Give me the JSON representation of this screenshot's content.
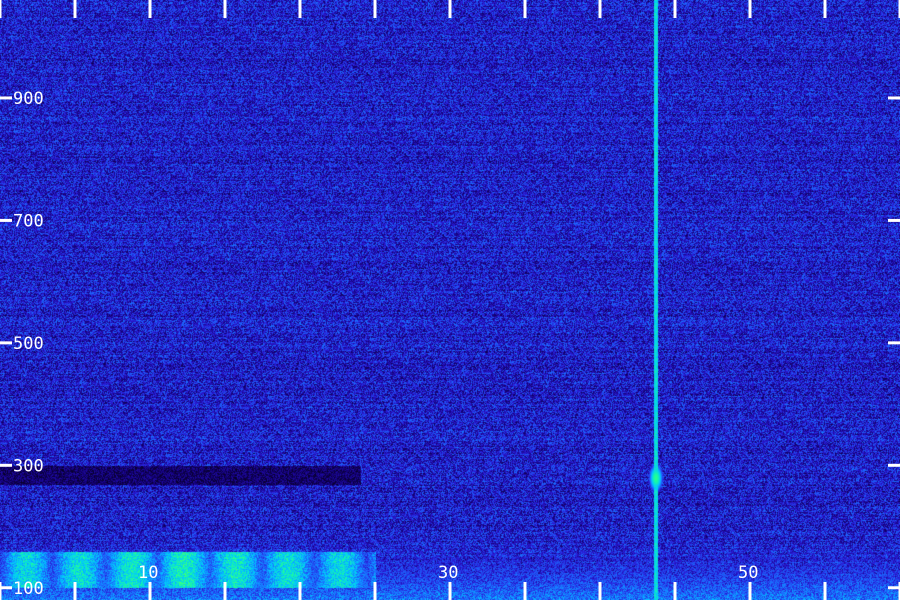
{
  "chart_data": {
    "type": "heatmap",
    "title": "",
    "xlabel": "",
    "ylabel": "",
    "x_ticks": [
      0,
      5,
      10,
      15,
      20,
      25,
      30,
      35,
      40,
      45,
      50,
      55,
      60
    ],
    "x_tick_labels": [
      {
        "value": 10,
        "label": "10"
      },
      {
        "value": 30,
        "label": "30"
      },
      {
        "value": 50,
        "label": "50"
      }
    ],
    "y_ticks": [
      {
        "value": 900,
        "label": "900"
      },
      {
        "value": 700,
        "label": "700"
      },
      {
        "value": 500,
        "label": "500"
      },
      {
        "value": 300,
        "label": "300"
      },
      {
        "value": 100,
        "label": "100"
      }
    ],
    "xlim": [
      0,
      60
    ],
    "ylim": [
      80,
      1060
    ],
    "colormap": [
      "#000000",
      "#140078",
      "#2a1ad6",
      "#1b6cff",
      "#00c8ff",
      "#1cff9a",
      "#9aff2a"
    ],
    "background_level": 0.32,
    "features": [
      {
        "kind": "vertical_line",
        "x": 43.7,
        "y_from": 80,
        "y_to": 1060,
        "intensity": 0.72
      },
      {
        "kind": "dark_band",
        "x_from": 0,
        "x_to": 24,
        "y_from": 268,
        "y_to": 300,
        "intensity": 0.05
      },
      {
        "kind": "bright_patch",
        "x_from": 0,
        "x_to": 25,
        "y_from": 100,
        "y_to": 160,
        "intensity": 0.78
      },
      {
        "kind": "low_band",
        "x_from": 0,
        "x_to": 60,
        "y_from": 80,
        "y_to": 210,
        "intensity": 0.52
      },
      {
        "kind": "blob",
        "x": 43.7,
        "y": 280,
        "intensity": 0.85
      }
    ]
  }
}
